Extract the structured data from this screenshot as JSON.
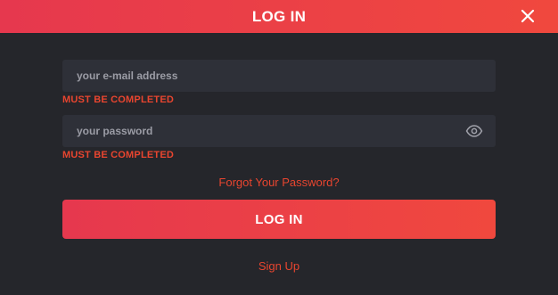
{
  "header": {
    "title": "LOG IN",
    "close_icon": "close-icon"
  },
  "form": {
    "email": {
      "value": "",
      "placeholder": "your e-mail address",
      "error": "MUST BE COMPLETED"
    },
    "password": {
      "value": "",
      "placeholder": "your password",
      "error": "MUST BE COMPLETED",
      "toggle_icon": "eye-icon"
    },
    "forgot_password": "Forgot Your Password?",
    "submit_label": "LOG IN",
    "signup_link": "Sign Up"
  },
  "colors": {
    "background": "#25262b",
    "field_background": "#2e3038",
    "accent_start": "#e6384e",
    "accent_end": "#f0483e",
    "error": "#e8452f"
  }
}
